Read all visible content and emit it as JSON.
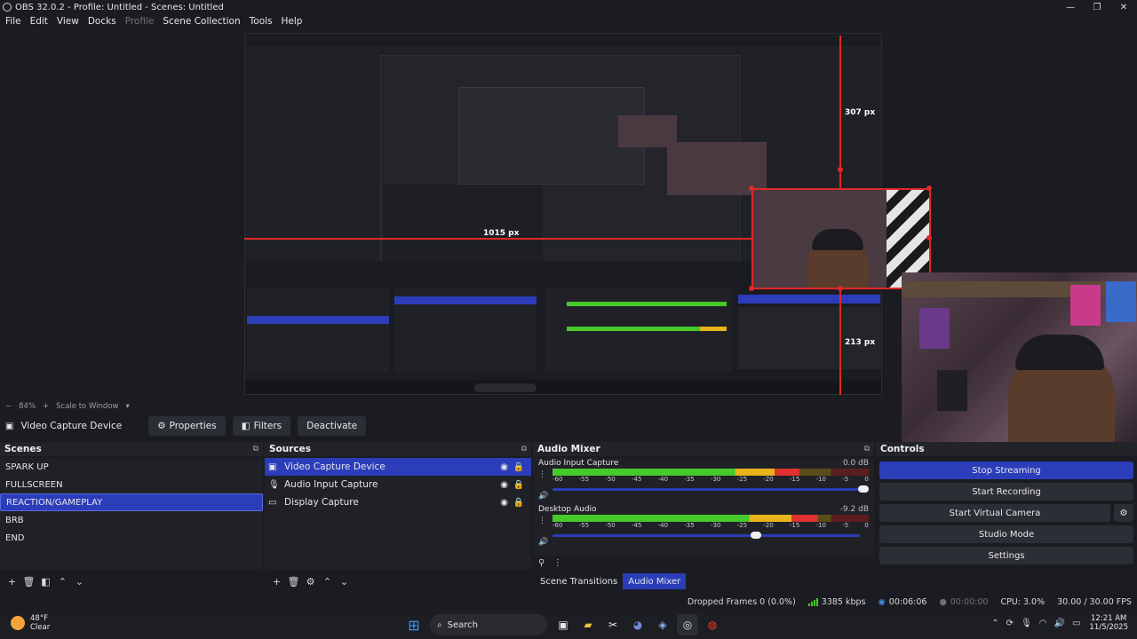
{
  "window": {
    "title": "OBS 32.0.2 - Profile: Untitled - Scenes: Untitled",
    "controls": [
      "—",
      "❐",
      "✕"
    ]
  },
  "menu": [
    "File",
    "Edit",
    "View",
    "Docks",
    "Profile",
    "Scene Collection",
    "Tools",
    "Help"
  ],
  "preview": {
    "labels": {
      "width": "1015 px",
      "height": "307 px",
      "right_gap": "213 px"
    },
    "zoom": "84%",
    "scale_mode": "Scale to Window"
  },
  "context_bar": {
    "source": "Video Capture Device",
    "properties": "Properties",
    "filters": "Filters",
    "deactivate": "Deactivate"
  },
  "scenes": {
    "title": "Scenes",
    "items": [
      "SPARK UP",
      "FULLSCREEN",
      "REACTION/GAMEPLAY",
      "BRB",
      "END"
    ],
    "selected": "REACTION/GAMEPLAY"
  },
  "sources": {
    "title": "Sources",
    "items": [
      "Video Capture Device",
      "Audio Input Capture",
      "Display Capture"
    ],
    "selected": "Video Capture Device"
  },
  "mixer": {
    "title": "Audio Mixer",
    "ticks": [
      "-60",
      "-55",
      "-50",
      "-45",
      "-40",
      "-35",
      "-30",
      "-25",
      "-20",
      "-15",
      "-10",
      "-5",
      "0"
    ],
    "channels": [
      {
        "name": "Audio Input Capture",
        "db": "0.0 dB",
        "level": 0.78,
        "volume": 1.0
      },
      {
        "name": "Desktop Audio",
        "db": "-9.2 dB",
        "level": 0.84,
        "volume": 0.66
      }
    ],
    "tabs": [
      "Scene Transitions",
      "Audio Mixer"
    ],
    "active_tab": "Audio Mixer"
  },
  "controls": {
    "title": "Controls",
    "stop_streaming": "Stop Streaming",
    "start_recording": "Start Recording",
    "start_virtual_camera": "Start Virtual Camera",
    "studio_mode": "Studio Mode",
    "settings": "Settings"
  },
  "status": {
    "dropped": "Dropped Frames 0 (0.0%)",
    "bitrate": "3385 kbps",
    "stream_time": "00:06:06",
    "rec_time": "00:00:00",
    "cpu": "CPU: 3.0%",
    "fps": "30.00 / 30.00 FPS"
  },
  "taskbar": {
    "temp": "48°F",
    "condition": "Clear",
    "search": "Search",
    "time": "12:21 AM",
    "date": "11/5/2025"
  },
  "colors": {
    "accent": "#2b3db8",
    "guide_red": "#e02828",
    "meter_green": "#46c92b"
  }
}
